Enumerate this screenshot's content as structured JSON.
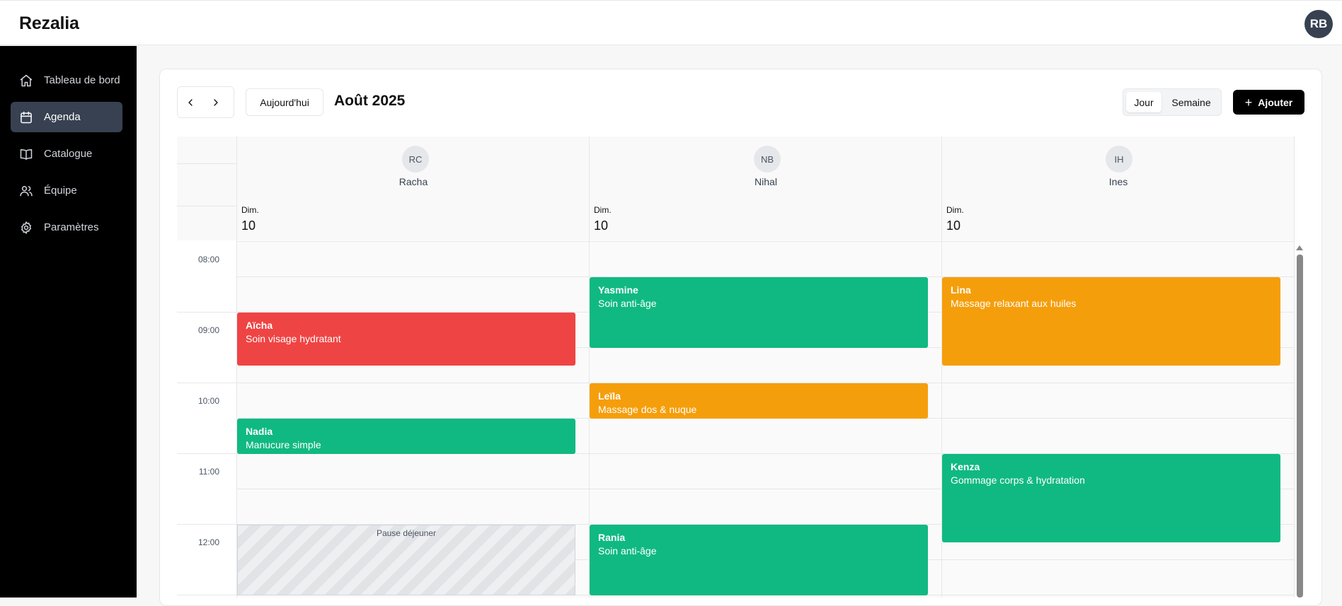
{
  "app": {
    "brand": "Rezalia",
    "user_initials": "RB"
  },
  "sidebar": {
    "items": [
      {
        "label": "Tableau de bord",
        "icon": "home-icon",
        "active": false
      },
      {
        "label": "Agenda",
        "icon": "calendar-icon",
        "active": true
      },
      {
        "label": "Catalogue",
        "icon": "book-icon",
        "active": false
      },
      {
        "label": "Équipe",
        "icon": "users-icon",
        "active": false
      },
      {
        "label": "Paramètres",
        "icon": "gear-icon",
        "active": false
      }
    ]
  },
  "toolbar": {
    "today_label": "Aujourd'hui",
    "month_title": "Août 2025",
    "views": [
      "Jour",
      "Semaine"
    ],
    "active_view": "Jour",
    "add_label": "Ajouter"
  },
  "calendar": {
    "resources": [
      {
        "initials": "RC",
        "name": "Racha",
        "day_short": "Dim.",
        "day_num": "10"
      },
      {
        "initials": "NB",
        "name": "Nihal",
        "day_short": "Dim.",
        "day_num": "10"
      },
      {
        "initials": "IH",
        "name": "Ines",
        "day_short": "Dim.",
        "day_num": "10"
      }
    ],
    "hours": [
      "08:00",
      "09:00",
      "10:00",
      "11:00",
      "12:00"
    ],
    "events": [
      {
        "name": "Aïcha",
        "service": "Soin visage hydratant",
        "color": "#ef4444"
      },
      {
        "name": "Nadia",
        "service": "Manucure simple",
        "color": "#10b981"
      },
      {
        "name": "Yasmine",
        "service": "Soin anti-âge",
        "color": "#10b981"
      },
      {
        "name": "Leïla",
        "service": "Massage dos & nuque",
        "color": "#f59e0b"
      },
      {
        "name": "Rania",
        "service": "Soin anti-âge",
        "color": "#10b981"
      },
      {
        "name": "Lina",
        "service": "Massage relaxant aux huiles",
        "color": "#f59e0b"
      },
      {
        "name": "Kenza",
        "service": "Gommage corps & hydratation",
        "color": "#10b981"
      }
    ],
    "break_label": "Pause déjeuner"
  },
  "colors": {
    "sidebar_bg": "#000000",
    "active_nav": "#374151",
    "green": "#10b981",
    "orange": "#f59e0b",
    "red": "#ef4444"
  }
}
